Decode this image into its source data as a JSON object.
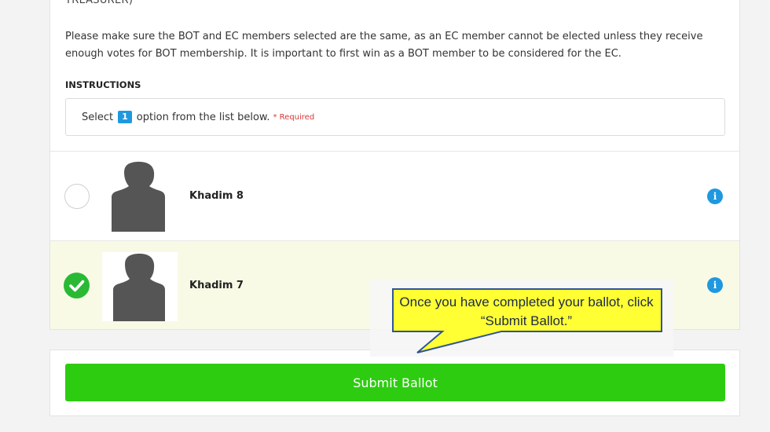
{
  "ballot": {
    "cut_heading": "TREASURER)",
    "intro": "Please make sure the BOT and EC members selected are the same, as an EC member cannot be elected unless they receive enough votes for BOT membership. It is important to first win as a BOT member to be considered for the EC.",
    "instructions_heading": "INSTRUCTIONS",
    "instructions": {
      "select_prefix": "Select",
      "count": "1",
      "select_suffix": "option from the list below.",
      "required": "* Required"
    },
    "candidates": [
      {
        "name": "Khadim 8",
        "selected": false
      },
      {
        "name": "Khadim 7",
        "selected": true
      }
    ],
    "info_glyph": "i"
  },
  "submit": {
    "label": "Submit Ballot"
  },
  "callout": {
    "text": "Once you have completed your ballot, click “Submit Ballot.”"
  },
  "colors": {
    "accent": "#1f98e0",
    "selected_row": "#f8fae6",
    "check": "#2ab934",
    "submit": "#2ecc11",
    "callout_fill": "#ffff33"
  },
  "icons": {
    "radio_unchecked": "circle-outline-icon",
    "radio_checked": "checkmark-circle-icon",
    "info": "info-circle-icon",
    "avatar": "person-silhouette-icon"
  }
}
